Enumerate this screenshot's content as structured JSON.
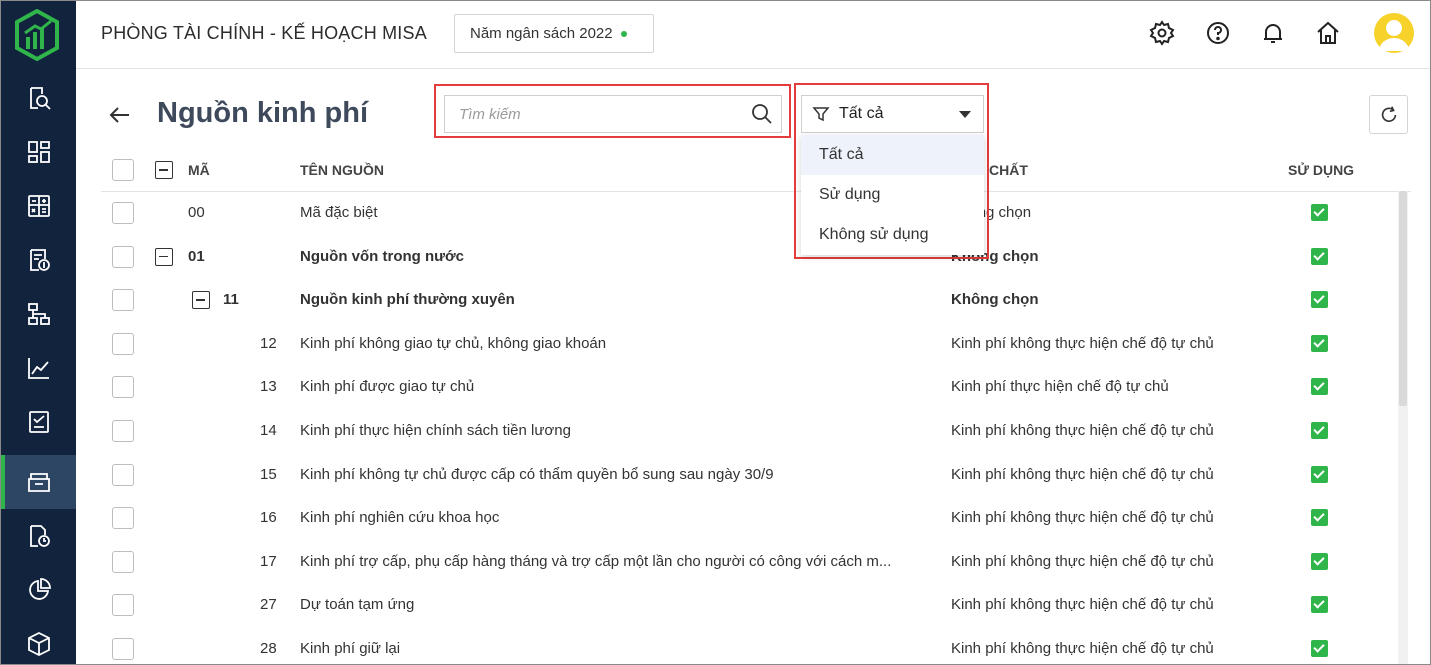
{
  "app": {
    "title": "PHÒNG TÀI CHÍNH - KẾ HOẠCH MISA",
    "year": "Năm ngân sách 2022"
  },
  "colors": {
    "sidebar_bg": "#12233d",
    "accent_green": "#2fb54a",
    "highlight_red": "#e43b3b"
  },
  "sidebar": {
    "items": [
      {
        "icon": "search-document-icon"
      },
      {
        "icon": "dashboard-icon"
      },
      {
        "icon": "calculator-icon"
      },
      {
        "icon": "budget-icon"
      },
      {
        "icon": "org-chart-icon"
      },
      {
        "icon": "chart-line-icon"
      },
      {
        "icon": "report-icon"
      },
      {
        "icon": "folder-icon",
        "active": true
      },
      {
        "icon": "document-clock-icon"
      },
      {
        "icon": "pie-chart-icon"
      },
      {
        "icon": "box-icon"
      }
    ]
  },
  "topbar": {
    "icons": [
      "gear-icon",
      "help-icon",
      "bell-icon",
      "home-icon",
      "avatar-icon"
    ]
  },
  "page": {
    "title": "Nguồn kinh phí"
  },
  "search": {
    "placeholder": "Tìm kiếm"
  },
  "filter": {
    "selected": "Tất cả",
    "options": [
      "Tất cả",
      "Sử dụng",
      "Không sử dụng"
    ]
  },
  "table": {
    "headers": {
      "code": "MÃ",
      "name": "TÊN NGUỒN",
      "nature": "CHẤT",
      "used": "SỬ DỤNG"
    },
    "rows": [
      {
        "code": "00",
        "name": "Mã đặc biệt",
        "nature": "Không chọn",
        "bold": false,
        "used": true
      },
      {
        "code": "01",
        "name": "Nguồn vốn trong nước",
        "nature": "Không chọn",
        "bold": true,
        "used": true
      },
      {
        "code": "11",
        "name": "Nguồn kinh phí thường xuyên",
        "nature": "Không chọn",
        "bold": true,
        "used": true
      },
      {
        "code": "12",
        "name": "Kinh phí không giao tự chủ, không giao khoán",
        "nature": "Kinh phí không thực hiện chế độ tự chủ",
        "bold": false,
        "used": true
      },
      {
        "code": "13",
        "name": "Kinh phí được giao tự chủ",
        "nature": "Kinh phí thực hiện chế độ tự chủ",
        "bold": false,
        "used": true
      },
      {
        "code": "14",
        "name": "Kinh phí thực hiện chính sách tiền lương",
        "nature": "Kinh phí không thực hiện chế độ tự chủ",
        "bold": false,
        "used": true
      },
      {
        "code": "15",
        "name": "Kinh phí không tự chủ được cấp có thẩm quyền bổ sung sau ngày 30/9",
        "nature": "Kinh phí không thực hiện chế độ tự chủ",
        "bold": false,
        "used": true
      },
      {
        "code": "16",
        "name": "Kinh phí nghiên cứu khoa học",
        "nature": "Kinh phí không thực hiện chế độ tự chủ",
        "bold": false,
        "used": true
      },
      {
        "code": "17",
        "name": "Kinh phí trợ cấp, phụ cấp hàng tháng và trợ cấp một lần cho người có công với cách m...",
        "nature": "Kinh phí không thực hiện chế độ tự chủ",
        "bold": false,
        "used": true
      },
      {
        "code": "27",
        "name": "Dự toán tạm ứng",
        "nature": "Kinh phí không thực hiện chế độ tự chủ",
        "bold": false,
        "used": true
      },
      {
        "code": "28",
        "name": "Kinh phí giữ lại",
        "nature": "Kinh phí không thực hiện chế độ tự chủ",
        "bold": false,
        "used": true
      }
    ]
  }
}
